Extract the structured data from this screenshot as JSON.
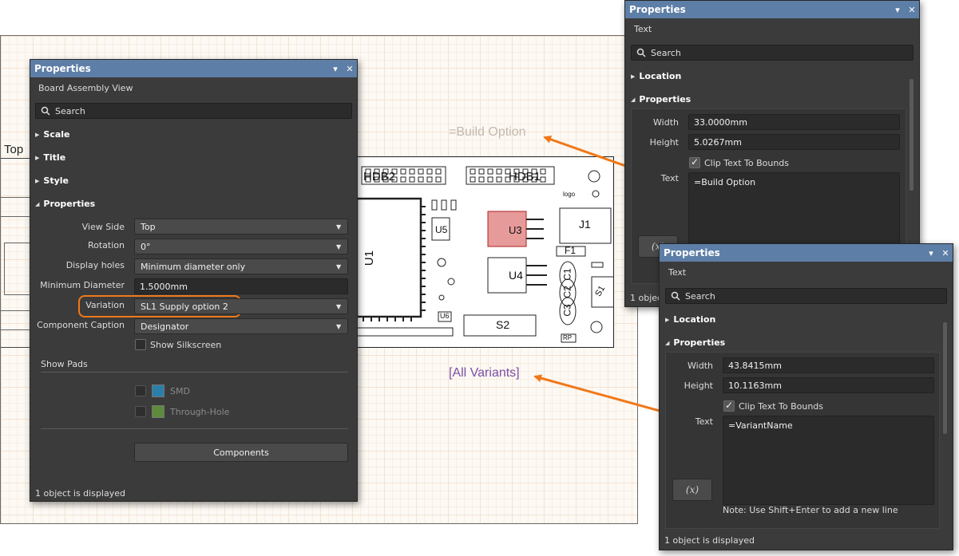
{
  "canvas": {
    "sheet_label": "Top",
    "build_option_text": "=Build Option",
    "all_variants_text": "[All Variants]"
  },
  "pcb": {
    "designators": {
      "hdb2": "HDB2",
      "hdb1": "HDB1",
      "u1": "U1",
      "u3": "U3",
      "u4": "U4",
      "u5": "U5",
      "u6": "U6",
      "j1": "J1",
      "f1": "F1",
      "c1": "C1",
      "c2": "C2",
      "c3": "C3",
      "s1": "S1",
      "s2": "S2",
      "logo": "logo",
      "rp": "RP"
    },
    "colors": {
      "outline": "#222222",
      "u3_fill": "#e79a9a"
    }
  },
  "left_panel": {
    "title": "Properties",
    "subtitle": "Board Assembly View",
    "search_placeholder": "Search",
    "sections": {
      "scale": "Scale",
      "title": "Title",
      "style": "Style",
      "properties": "Properties"
    },
    "rows": {
      "view_side": {
        "label": "View Side",
        "value": "Top"
      },
      "rotation": {
        "label": "Rotation",
        "value": "0°"
      },
      "display_holes": {
        "label": "Display holes",
        "value": "Minimum diameter only"
      },
      "minimum_diameter": {
        "label": "Minimum Diameter",
        "value": "1.5000mm"
      },
      "variation": {
        "label": "Variation",
        "value": "SL1 Supply option 2"
      },
      "component_caption": {
        "label": "Component Caption",
        "value": "Designator"
      }
    },
    "show_silkscreen": {
      "label": "Show Silkscreen",
      "checked": false
    },
    "show_pads": {
      "label": "Show Pads",
      "smd": {
        "label": "SMD",
        "color": "#2a7fa8"
      },
      "through_hole": {
        "label": "Through-Hole",
        "color": "#5e8a3c"
      }
    },
    "components_button": "Components",
    "status": "1 object is displayed",
    "highlight_color": "#f07818"
  },
  "build_option_panel": {
    "title": "Properties",
    "subtitle": "Text",
    "search_placeholder": "Search",
    "sections": {
      "location": "Location",
      "properties": "Properties"
    },
    "width": {
      "label": "Width",
      "value": "33.0000mm"
    },
    "height": {
      "label": "Height",
      "value": "5.0267mm"
    },
    "clip": {
      "label": "Clip Text To Bounds",
      "checked": true
    },
    "text": {
      "label": "Text",
      "value": "=Build Option"
    },
    "fx_label": "(x)",
    "status": "1 object is displayed"
  },
  "variant_panel": {
    "title": "Properties",
    "subtitle": "Text",
    "search_placeholder": "Search",
    "sections": {
      "location": "Location",
      "properties": "Properties"
    },
    "width": {
      "label": "Width",
      "value": "43.8415mm"
    },
    "height": {
      "label": "Height",
      "value": "10.1163mm"
    },
    "clip": {
      "label": "Clip Text To Bounds",
      "checked": true
    },
    "text": {
      "label": "Text",
      "value": "=VariantName"
    },
    "fx_label": "(x)",
    "note": "Note: Use Shift+Enter to add a new line",
    "status": "1 object is displayed"
  },
  "icons": {
    "titlebar_pin": "▾",
    "titlebar_close": "✕",
    "expand_closed": "▶",
    "expand_open": "◢",
    "dropdown": "▼"
  },
  "arrow_color": "#f07818"
}
